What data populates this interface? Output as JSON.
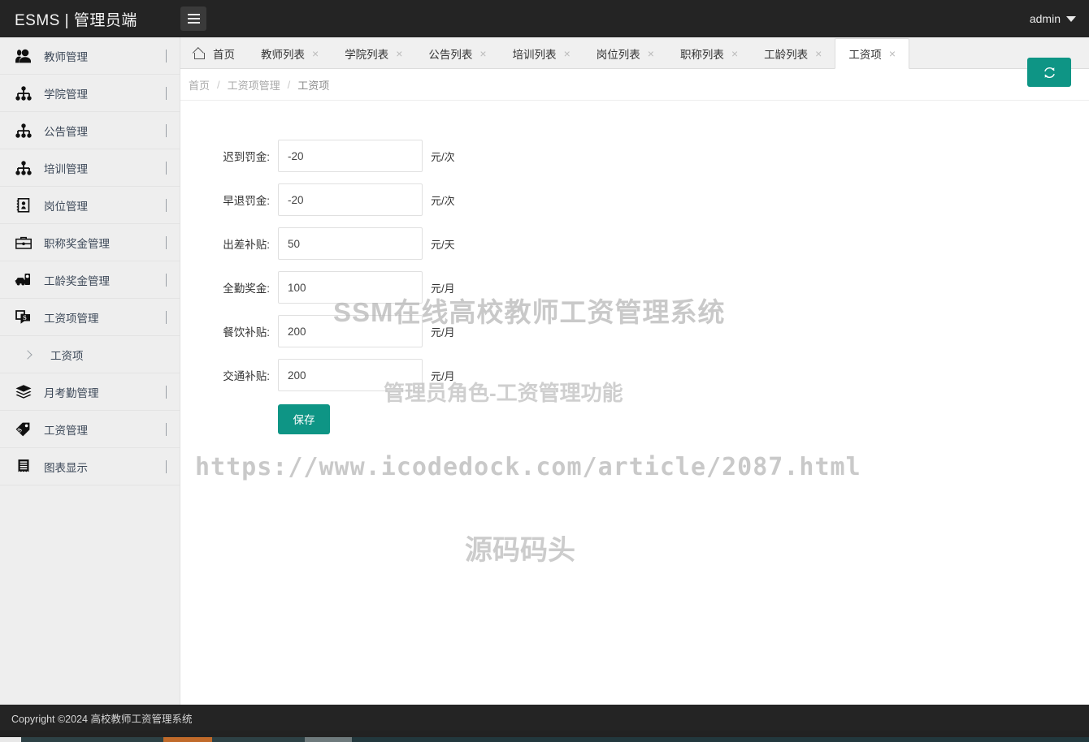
{
  "topbar": {
    "brand": "ESMS | 管理员端",
    "menu_toggle_icon": "hamburger-icon",
    "user": "admin",
    "user_caret_icon": "caret-down-icon"
  },
  "sidebar": {
    "items": [
      {
        "label": "教师管理",
        "icon": "users-icon",
        "arrow": "chevron-left",
        "expanded": false
      },
      {
        "label": "学院管理",
        "icon": "sitemap-icon",
        "arrow": "chevron-left",
        "expanded": false
      },
      {
        "label": "公告管理",
        "icon": "sitemap-icon",
        "arrow": "chevron-left",
        "expanded": false
      },
      {
        "label": "培训管理",
        "icon": "sitemap-icon",
        "arrow": "chevron-left",
        "expanded": false
      },
      {
        "label": "岗位管理",
        "icon": "address-book-icon",
        "arrow": "chevron-left",
        "expanded": false
      },
      {
        "label": "职称奖金管理",
        "icon": "briefcase-icon",
        "arrow": "chevron-left",
        "expanded": false
      },
      {
        "label": "工龄奖金管理",
        "icon": "toolbox-icon",
        "arrow": "chevron-left",
        "expanded": false
      },
      {
        "label": "工资项管理",
        "icon": "money-note-icon",
        "arrow": "chevron-down",
        "expanded": true
      },
      {
        "label": "月考勤管理",
        "icon": "layers-icon",
        "arrow": "chevron-left",
        "expanded": false
      },
      {
        "label": "工资管理",
        "icon": "price-tag-icon",
        "arrow": "chevron-left",
        "expanded": false
      },
      {
        "label": "图表显示",
        "icon": "receipt-icon",
        "arrow": "chevron-left",
        "expanded": false
      }
    ],
    "submenu": {
      "parent_index": 7,
      "label": "工资项",
      "icon": "chevron-right-icon"
    }
  },
  "tabs": [
    {
      "label": "首页",
      "icon": "home-icon",
      "closable": false,
      "active": false
    },
    {
      "label": "教师列表",
      "closable": true,
      "active": false
    },
    {
      "label": "学院列表",
      "closable": true,
      "active": false
    },
    {
      "label": "公告列表",
      "closable": true,
      "active": false
    },
    {
      "label": "培训列表",
      "closable": true,
      "active": false
    },
    {
      "label": "岗位列表",
      "closable": true,
      "active": false
    },
    {
      "label": "职称列表",
      "closable": true,
      "active": false
    },
    {
      "label": "工龄列表",
      "closable": true,
      "active": false
    },
    {
      "label": "工资项",
      "closable": true,
      "active": true
    }
  ],
  "tab_close_glyph": "×",
  "breadcrumb": {
    "items": [
      "首页",
      "工资项管理",
      "工资项"
    ],
    "separator": "/"
  },
  "refresh_button": {
    "icon": "refresh-icon",
    "color": "#0e9585"
  },
  "form": {
    "fields": [
      {
        "label": "迟到罚金:",
        "value": "-20",
        "unit": "元/次",
        "name": "late-penalty"
      },
      {
        "label": "早退罚金:",
        "value": "-20",
        "unit": "元/次",
        "name": "early-leave-penalty"
      },
      {
        "label": "出差补贴:",
        "value": "50",
        "unit": "元/天",
        "name": "business-trip-allowance"
      },
      {
        "label": "全勤奖金:",
        "value": "100",
        "unit": "元/月",
        "name": "full-attendance-bonus"
      },
      {
        "label": "餐饮补贴:",
        "value": "200",
        "unit": "元/月",
        "name": "meal-allowance"
      },
      {
        "label": "交通补贴:",
        "value": "200",
        "unit": "元/月",
        "name": "transport-allowance"
      }
    ],
    "save_label": "保存",
    "save_color": "#0e9585"
  },
  "watermarks": {
    "title": "SSM在线高校教师工资管理系统",
    "subtitle": "管理员角色-工资管理功能",
    "url": "https://www.icodedock.com/article/2087.html",
    "brand": "源码码头"
  },
  "footer": {
    "text": "Copyright ©2024 高校教师工资管理系统"
  }
}
